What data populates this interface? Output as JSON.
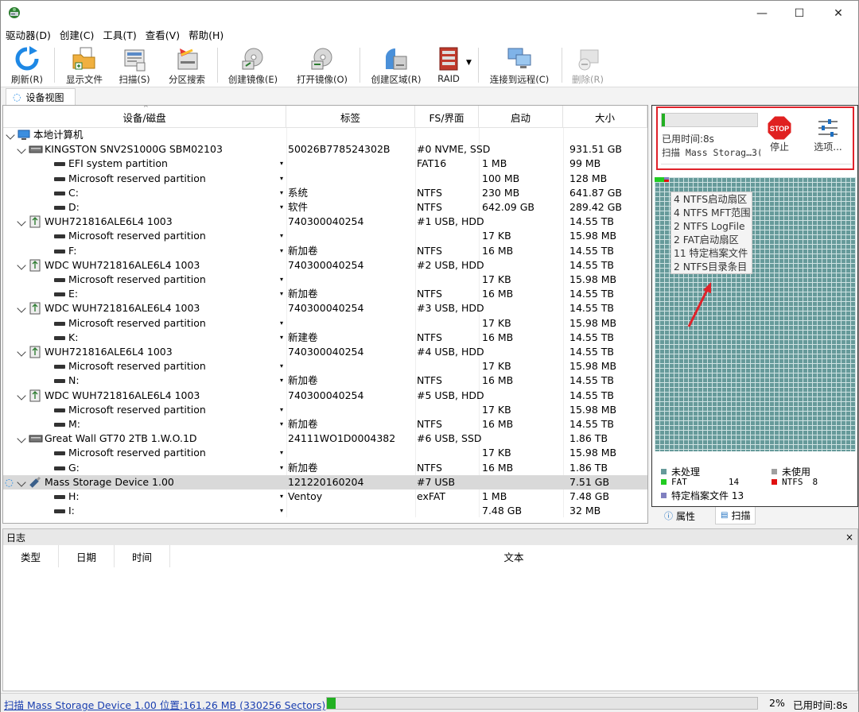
{
  "window": {
    "minimize": "—",
    "maximize": "☐",
    "close": "✕"
  },
  "menu": [
    "驱动器(D)",
    "创建(C)",
    "工具(T)",
    "查看(V)",
    "帮助(H)"
  ],
  "toolbar": {
    "refresh": "刷新(R)",
    "show_files": "显示文件",
    "scan": "扫描(S)",
    "partition_search": "分区搜索",
    "create_image": "创建镜像(E)",
    "open_image": "打开镜像(O)",
    "create_region": "创建区域(R)",
    "raid": "RAID",
    "connect_remote": "连接到远程(C)",
    "delete": "删除(R)"
  },
  "view_tab": "设备视图",
  "table": {
    "headers": [
      "设备/磁盘",
      "标签",
      "FS/界面",
      "启动",
      "大小"
    ],
    "rows": [
      {
        "level": 0,
        "icon": "computer",
        "name": "本地计算机",
        "label": "",
        "fs": "",
        "start": "",
        "size": ""
      },
      {
        "level": 1,
        "icon": "ssd",
        "name": "KINGSTON SNV2S1000G SBM02103",
        "label": "50026B778524302B",
        "fs": "#0 NVME, SSD",
        "start": "",
        "size": "931.51 GB"
      },
      {
        "level": 2,
        "icon": "part",
        "name": "EFI system partition",
        "dd": true,
        "label": "",
        "fs": "FAT16",
        "start": "1 MB",
        "size": "99 MB"
      },
      {
        "level": 2,
        "icon": "part",
        "name": "Microsoft reserved partition",
        "dd": true,
        "label": "",
        "fs": "",
        "start": "100 MB",
        "size": "128 MB"
      },
      {
        "level": 2,
        "icon": "part",
        "name": "C:",
        "dd": true,
        "label": "系统",
        "fs": "NTFS",
        "start": "230 MB",
        "size": "641.87 GB"
      },
      {
        "level": 2,
        "icon": "part",
        "name": "D:",
        "dd": true,
        "label": "软件",
        "fs": "NTFS",
        "start": "642.09 GB",
        "size": "289.42 GB"
      },
      {
        "level": 1,
        "icon": "usb",
        "name": "WUH721816ALE6L4 1003",
        "label": "740300040254",
        "fs": "#1 USB, HDD",
        "start": "",
        "size": "14.55 TB"
      },
      {
        "level": 2,
        "icon": "part",
        "name": "Microsoft reserved partition",
        "dd": true,
        "label": "",
        "fs": "",
        "start": "17 KB",
        "size": "15.98 MB"
      },
      {
        "level": 2,
        "icon": "part",
        "name": "F:",
        "dd": true,
        "label": "新加卷",
        "fs": "NTFS",
        "start": "16 MB",
        "size": "14.55 TB"
      },
      {
        "level": 1,
        "icon": "usb",
        "name": "WDC WUH721816ALE6L4 1003",
        "label": "740300040254",
        "fs": "#2 USB, HDD",
        "start": "",
        "size": "14.55 TB"
      },
      {
        "level": 2,
        "icon": "part",
        "name": "Microsoft reserved partition",
        "dd": true,
        "label": "",
        "fs": "",
        "start": "17 KB",
        "size": "15.98 MB"
      },
      {
        "level": 2,
        "icon": "part",
        "name": "E:",
        "dd": true,
        "label": "新加卷",
        "fs": "NTFS",
        "start": "16 MB",
        "size": "14.55 TB"
      },
      {
        "level": 1,
        "icon": "usb",
        "name": "WDC WUH721816ALE6L4 1003",
        "label": "740300040254",
        "fs": "#3 USB, HDD",
        "start": "",
        "size": "14.55 TB"
      },
      {
        "level": 2,
        "icon": "part",
        "name": "Microsoft reserved partition",
        "dd": true,
        "label": "",
        "fs": "",
        "start": "17 KB",
        "size": "15.98 MB"
      },
      {
        "level": 2,
        "icon": "part",
        "name": "K:",
        "dd": true,
        "label": "新建卷",
        "fs": "NTFS",
        "start": "16 MB",
        "size": "14.55 TB"
      },
      {
        "level": 1,
        "icon": "usb",
        "name": "WUH721816ALE6L4 1003",
        "label": "740300040254",
        "fs": "#4 USB, HDD",
        "start": "",
        "size": "14.55 TB"
      },
      {
        "level": 2,
        "icon": "part",
        "name": "Microsoft reserved partition",
        "dd": true,
        "label": "",
        "fs": "",
        "start": "17 KB",
        "size": "15.98 MB"
      },
      {
        "level": 2,
        "icon": "part",
        "name": "N:",
        "dd": true,
        "label": "新加卷",
        "fs": "NTFS",
        "start": "16 MB",
        "size": "14.55 TB"
      },
      {
        "level": 1,
        "icon": "usb",
        "name": "WDC WUH721816ALE6L4 1003",
        "label": "740300040254",
        "fs": "#5 USB, HDD",
        "start": "",
        "size": "14.55 TB"
      },
      {
        "level": 2,
        "icon": "part",
        "name": "Microsoft reserved partition",
        "dd": true,
        "label": "",
        "fs": "",
        "start": "17 KB",
        "size": "15.98 MB"
      },
      {
        "level": 2,
        "icon": "part",
        "name": "M:",
        "dd": true,
        "label": "新加卷",
        "fs": "NTFS",
        "start": "16 MB",
        "size": "14.55 TB"
      },
      {
        "level": 1,
        "icon": "ssd",
        "name": "Great Wall GT70 2TB 1.W.O.1D",
        "label": "24111WO1D0004382",
        "fs": "#6 USB, SSD",
        "start": "",
        "size": "1.86 TB"
      },
      {
        "level": 2,
        "icon": "part",
        "name": "Microsoft reserved partition",
        "dd": true,
        "label": "",
        "fs": "",
        "start": "17 KB",
        "size": "15.98 MB"
      },
      {
        "level": 2,
        "icon": "part",
        "name": "G:",
        "dd": true,
        "label": "新加卷",
        "fs": "NTFS",
        "start": "16 MB",
        "size": "1.86 TB"
      },
      {
        "level": 1,
        "icon": "usbstick",
        "name": "Mass Storage Device 1.00",
        "label": "121220160204",
        "fs": "#7 USB",
        "start": "",
        "size": "7.51 GB",
        "selected": true,
        "scanning": true
      },
      {
        "level": 2,
        "icon": "part",
        "name": "H:",
        "dd": true,
        "label": "Ventoy",
        "fs": "exFAT",
        "start": "1 MB",
        "size": "7.48 GB"
      },
      {
        "level": 2,
        "icon": "part",
        "name": "I:",
        "dd": true,
        "label": "",
        "fs": "",
        "start": "7.48 GB",
        "size": "32 MB"
      }
    ]
  },
  "scan_panel": {
    "elapsed": "已用时间:8s",
    "scanning": "扫描 Mass Storag…3(",
    "stop_icon_text": "STOP",
    "stop": "停止",
    "options": "选项..."
  },
  "tooltip": [
    "4 NTFS启动扇区",
    "4 NTFS MFT范围",
    "2 NTFS LogFile",
    "2 FAT启动扇区",
    "11 特定档案文件",
    "2 NTFS目录条目"
  ],
  "legend": {
    "unprocessed": "未处理",
    "unused": "未使用",
    "fat": "FAT",
    "fat_count": "14",
    "ntfs": "NTFS",
    "ntfs_count": "8",
    "specific": "特定档案文件 13"
  },
  "colors": {
    "unprocessed": "#669a9a",
    "unused": "#a0a0a0",
    "fat": "#22cc22",
    "ntfs": "#e01010",
    "specific": "#8080c0",
    "progress": "#22b022",
    "highlight": "#e0222a"
  },
  "right_tabs": {
    "properties": "属性",
    "scan": "扫描"
  },
  "log": {
    "title": "日志",
    "close": "×",
    "columns": [
      "类型",
      "日期",
      "时间",
      "文本"
    ]
  },
  "status": {
    "text": "扫描 Mass Storage Device 1.00 位置:161.26 MB (330256 Sectors)",
    "percent": "2%",
    "elapsed": "已用时间:8s",
    "progress_fraction": 0.02
  }
}
